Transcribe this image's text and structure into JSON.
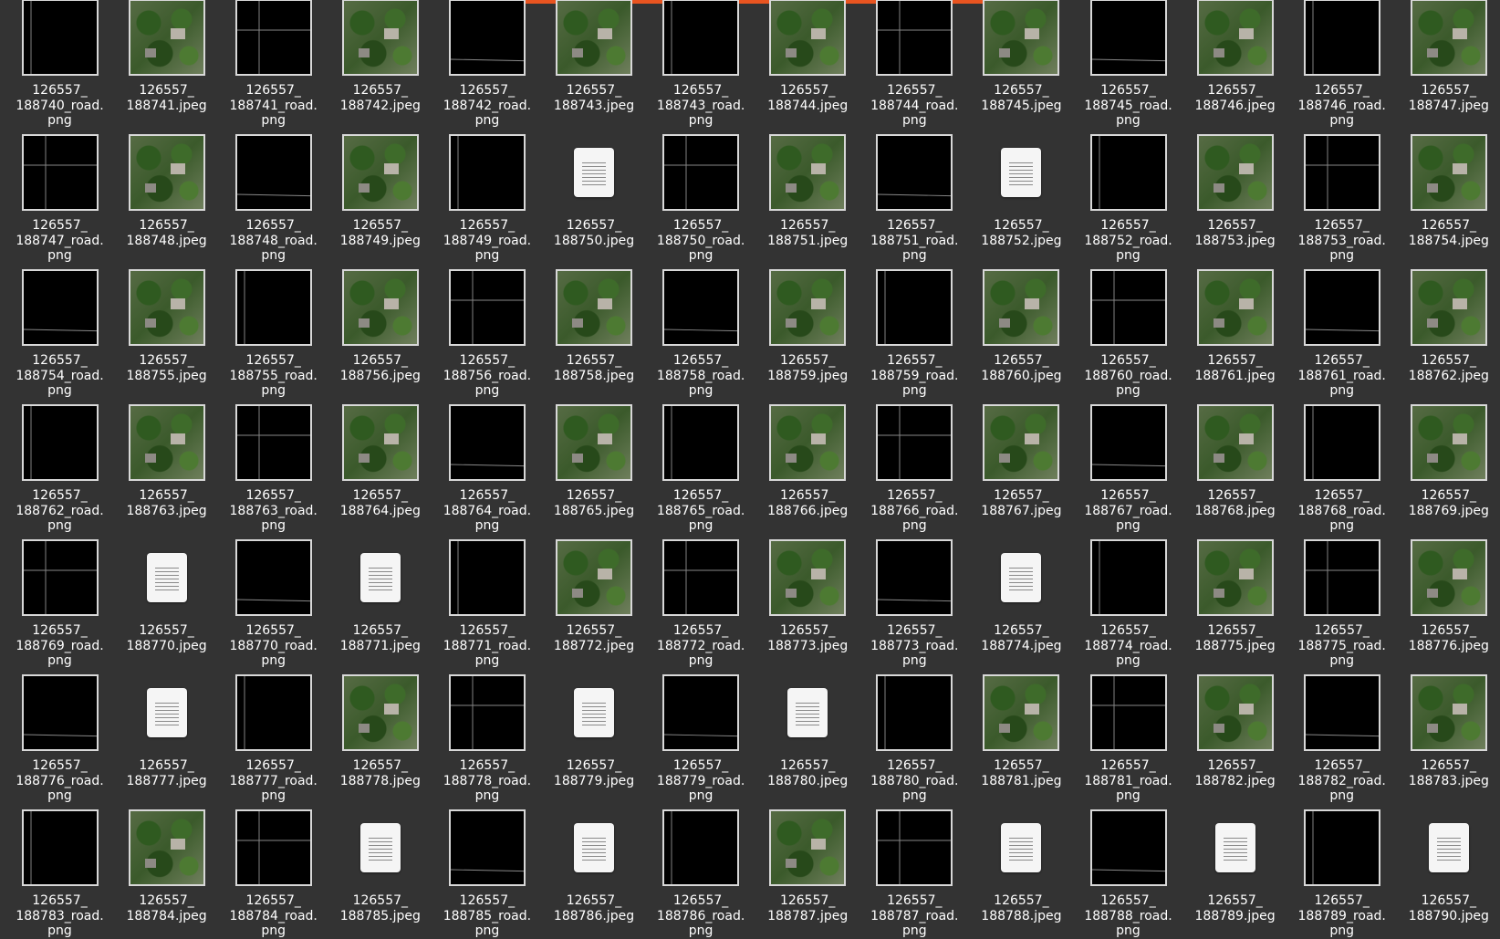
{
  "files": [
    "126557_\n188740_road.\npng",
    "126557_\n188741.jpeg",
    "126557_\n188741_road.\npng",
    "126557_\n188742.jpeg",
    "126557_\n188742_road.\npng",
    "126557_\n188743.jpeg",
    "126557_\n188743_road.\npng",
    "126557_\n188744.jpeg",
    "126557_\n188744_road.\npng",
    "126557_\n188745.jpeg",
    "126557_\n188745_road.\npng",
    "126557_\n188746.jpeg",
    "126557_\n188746_road.\npng",
    "126557_\n188747.jpeg",
    "126557_\n188747_road.\npng",
    "126557_\n188748.jpeg",
    "126557_\n188748_road.\npng",
    "126557_\n188749.jpeg",
    "126557_\n188749_road.\npng",
    "126557_\n188750.jpeg",
    "126557_\n188750_road.\npng",
    "126557_\n188751.jpeg",
    "126557_\n188751_road.\npng",
    "126557_\n188752.jpeg",
    "126557_\n188752_road.\npng",
    "126557_\n188753.jpeg",
    "126557_\n188753_road.\npng",
    "126557_\n188754.jpeg",
    "126557_\n188754_road.\npng",
    "126557_\n188755.jpeg",
    "126557_\n188755_road.\npng",
    "126557_\n188756.jpeg",
    "126557_\n188756_road.\npng",
    "126557_\n188758.jpeg",
    "126557_\n188758_road.\npng",
    "126557_\n188759.jpeg",
    "126557_\n188759_road.\npng",
    "126557_\n188760.jpeg",
    "126557_\n188760_road.\npng",
    "126557_\n188761.jpeg",
    "126557_\n188761_road.\npng",
    "126557_\n188762.jpeg",
    "126557_\n188762_road.\npng",
    "126557_\n188763.jpeg",
    "126557_\n188763_road.\npng",
    "126557_\n188764.jpeg",
    "126557_\n188764_road.\npng",
    "126557_\n188765.jpeg",
    "126557_\n188765_road.\npng",
    "126557_\n188766.jpeg",
    "126557_\n188766_road.\npng",
    "126557_\n188767.jpeg",
    "126557_\n188767_road.\npng",
    "126557_\n188768.jpeg",
    "126557_\n188768_road.\npng",
    "126557_\n188769.jpeg",
    "126557_\n188769_road.\npng",
    "126557_\n188770.jpeg",
    "126557_\n188770_road.\npng",
    "126557_\n188771.jpeg",
    "126557_\n188771_road.\npng",
    "126557_\n188772.jpeg",
    "126557_\n188772_road.\npng",
    "126557_\n188773.jpeg",
    "126557_\n188773_road.\npng",
    "126557_\n188774.jpeg",
    "126557_\n188774_road.\npng",
    "126557_\n188775.jpeg",
    "126557_\n188775_road.\npng",
    "126557_\n188776.jpeg",
    "126557_\n188776_road.\npng",
    "126557_\n188777.jpeg",
    "126557_\n188777_road.\npng",
    "126557_\n188778.jpeg",
    "126557_\n188778_road.\npng",
    "126557_\n188779.jpeg",
    "126557_\n188779_road.\npng",
    "126557_\n188780.jpeg",
    "126557_\n188780_road.\npng",
    "126557_\n188781.jpeg",
    "126557_\n188781_road.\npng",
    "126557_\n188782.jpeg",
    "126557_\n188782_road.\npng",
    "126557_\n188783.jpeg",
    "126557_\n188783_road.\npng",
    "126557_\n188784.jpeg",
    "126557_\n188784_road.\npng",
    "126557_\n188785.jpeg",
    "126557_\n188785_road.\npng",
    "126557_\n188786.jpeg",
    "126557_\n188786_road.\npng",
    "126557_\n188787.jpeg",
    "126557_\n188787_road.\npng",
    "126557_\n188788.jpeg",
    "126557_\n188788_road.\npng",
    "126557_\n188789.jpeg",
    "126557_\n188789_road.\npng",
    "126557_\n188790.jpeg"
  ],
  "thumb_kinds": [
    "road",
    "aerial",
    "road",
    "aerial",
    "road",
    "aerial",
    "road",
    "aerial",
    "road",
    "aerial",
    "road",
    "aerial",
    "road",
    "aerial",
    "road",
    "aerial",
    "road",
    "aerial",
    "road",
    "doc",
    "road",
    "aerial",
    "road",
    "doc",
    "road",
    "aerial",
    "road",
    "aerial",
    "road",
    "aerial",
    "road",
    "aerial",
    "road",
    "aerial",
    "road",
    "aerial",
    "road",
    "aerial",
    "road",
    "aerial",
    "road",
    "aerial",
    "road",
    "aerial",
    "road",
    "aerial",
    "road",
    "aerial",
    "road",
    "aerial",
    "road",
    "aerial",
    "road",
    "aerial",
    "road",
    "aerial",
    "road",
    "doc",
    "road",
    "doc",
    "road",
    "aerial",
    "road",
    "aerial",
    "road",
    "doc",
    "road",
    "aerial",
    "road",
    "aerial",
    "road",
    "doc",
    "road",
    "aerial",
    "road",
    "doc",
    "road",
    "doc",
    "road",
    "aerial",
    "road",
    "aerial",
    "road",
    "aerial",
    "road",
    "aerial",
    "road",
    "doc",
    "road",
    "doc",
    "road",
    "aerial",
    "road",
    "doc",
    "road",
    "doc",
    "road",
    "doc",
    "road",
    "aerial",
    "road",
    "aerial",
    "road",
    "doc",
    "road",
    "doc",
    "road",
    "aerial",
    "road",
    "doc",
    "road",
    "doc"
  ],
  "icons": {
    "road_thumbnail": "road-mask-thumbnail",
    "image_thumbnail": "aerial-image-thumbnail",
    "generic": "document-icon"
  },
  "colors": {
    "background": "#333333",
    "accent": "#e95420",
    "text": "#ffffff"
  }
}
